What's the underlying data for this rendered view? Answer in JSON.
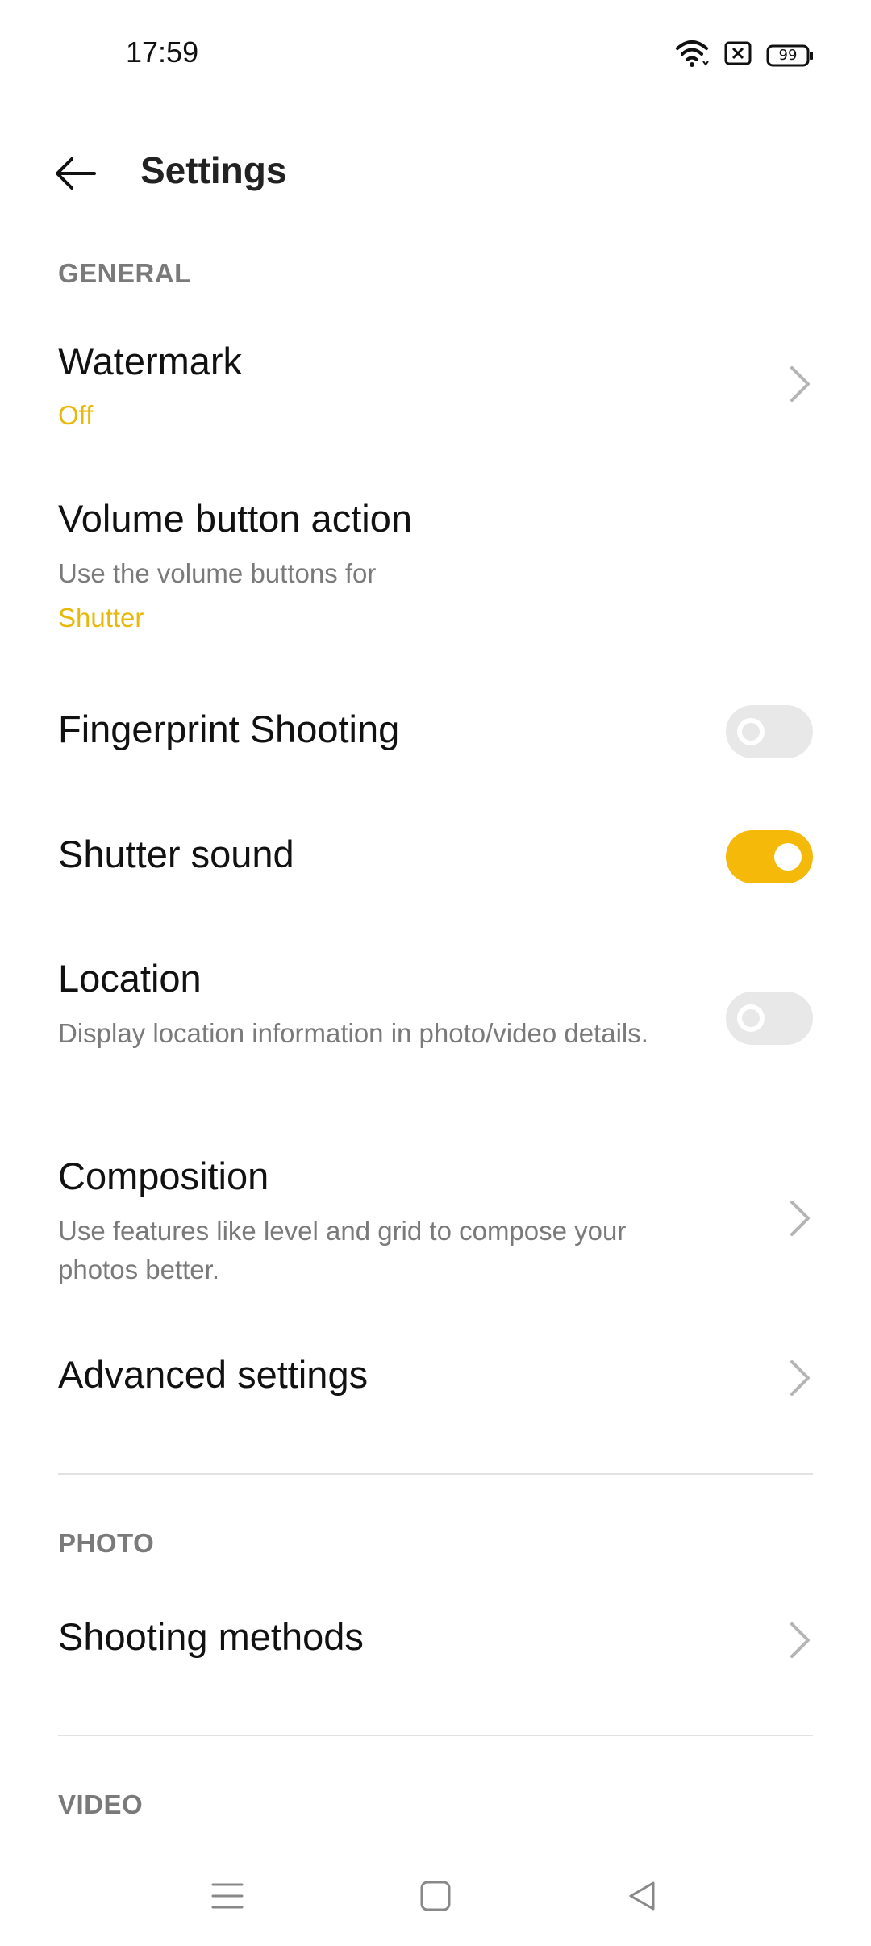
{
  "status_bar": {
    "time": "17:59",
    "battery": "99"
  },
  "header": {
    "title": "Settings"
  },
  "sections": {
    "general": "GENERAL",
    "photo": "PHOTO",
    "video": "VIDEO"
  },
  "settings": {
    "watermark": {
      "title": "Watermark",
      "value": "Off"
    },
    "volume": {
      "title": "Volume button action",
      "subtitle": "Use the volume buttons for",
      "value": "Shutter"
    },
    "fingerprint": {
      "title": "Fingerprint Shooting",
      "enabled": false
    },
    "shutter_sound": {
      "title": "Shutter sound",
      "enabled": true
    },
    "location": {
      "title": "Location",
      "subtitle": "Display location information in photo/video details.",
      "enabled": false
    },
    "composition": {
      "title": "Composition",
      "subtitle": "Use features like level and grid to compose your photos better."
    },
    "advanced": {
      "title": "Advanced settings"
    },
    "shooting_methods": {
      "title": "Shooting methods"
    }
  },
  "colors": {
    "accent": "#f5b90a",
    "value_text": "#e8b90a",
    "secondary_text": "#7a7a7a"
  },
  "icons": [
    "wifi-icon",
    "no-sim-icon",
    "battery-icon",
    "back-arrow-icon",
    "chevron-right-icon",
    "menu-icon",
    "home-icon",
    "back-icon"
  ]
}
